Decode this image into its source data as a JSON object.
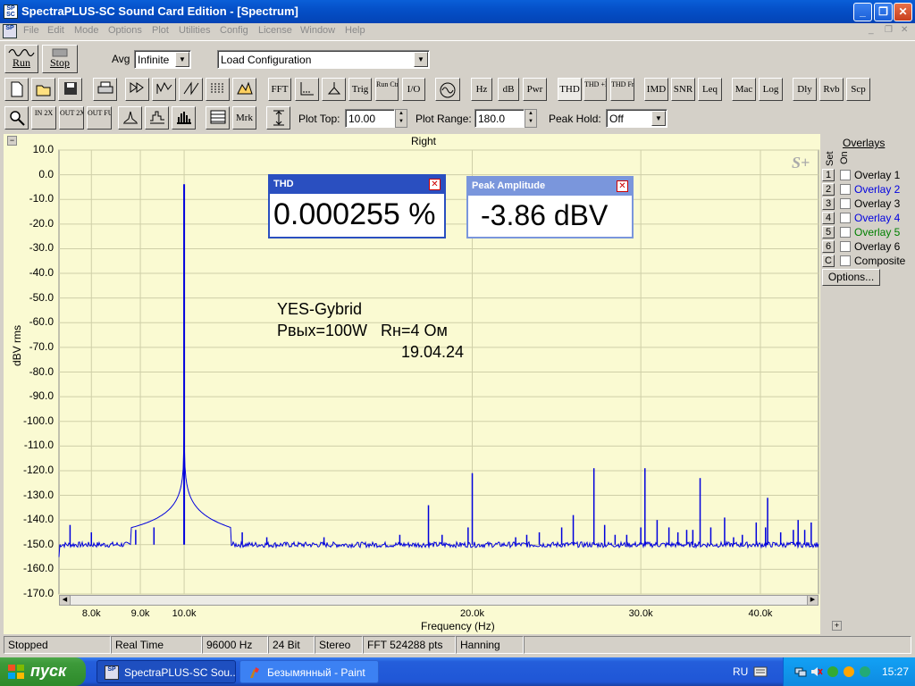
{
  "window": {
    "title": "SpectraPLUS-SC Sound Card Edition - [Spectrum]",
    "minimize": "_",
    "restore": "❐",
    "close": "✕"
  },
  "menu": [
    "File",
    "Edit",
    "Mode",
    "Options",
    "Plot",
    "Utilities",
    "Config",
    "License",
    "Window",
    "Help"
  ],
  "toolbar1": {
    "run_label": "Run",
    "stop_label": "Stop",
    "avg_label": "Avg",
    "avg_value": "Infinite",
    "config_value": "Load Configuration"
  },
  "toolbar2": {
    "fft": "FFT",
    "trig": "Trig",
    "run_ctrl": "Run Ctrl",
    "io": "I/O",
    "hz": "Hz",
    "db": "dB",
    "pwr": "Pwr",
    "thd": "THD",
    "thd_n": "THD +N",
    "thd_freq": "THD Freq",
    "imd": "IMD",
    "snr": "SNR",
    "leq": "Leq",
    "mac": "Mac",
    "log": "Log",
    "dly": "Dly",
    "rvb": "Rvb",
    "scp": "Scp"
  },
  "toolbar3": {
    "zoom_in": "IN 2X",
    "zoom_out": "OUT 2X",
    "zoom_full": "OUT FULL",
    "mrk": "Mrk",
    "plot_top_label": "Plot Top:",
    "plot_top_value": "10.00",
    "plot_range_label": "Plot Range:",
    "plot_range_value": "180.0",
    "peak_hold_label": "Peak Hold:",
    "peak_hold_value": "Off"
  },
  "plot": {
    "channel": "Right",
    "logo": "S+"
  },
  "chart_data": {
    "type": "line",
    "title": "Right",
    "xlabel": "Frequency (Hz)",
    "ylabel": "dBV rms",
    "xscale": "log",
    "xlim": [
      7400,
      46000
    ],
    "ylim": [
      -170,
      10
    ],
    "x_ticks": [
      {
        "v": 8000,
        "label": "8.0k"
      },
      {
        "v": 9000,
        "label": "9.0k"
      },
      {
        "v": 10000,
        "label": "10.0k"
      },
      {
        "v": 20000,
        "label": "20.0k"
      },
      {
        "v": 30000,
        "label": "30.0k"
      },
      {
        "v": 40000,
        "label": "40.0k"
      }
    ],
    "y_ticks": [
      {
        "v": 10,
        "label": "10.0"
      },
      {
        "v": 0,
        "label": "0.0"
      },
      {
        "v": -10,
        "label": "-10.0"
      },
      {
        "v": -20,
        "label": "-20.0"
      },
      {
        "v": -30,
        "label": "-30.0"
      },
      {
        "v": -40,
        "label": "-40.0"
      },
      {
        "v": -50,
        "label": "-50.0"
      },
      {
        "v": -60,
        "label": "-60.0"
      },
      {
        "v": -70,
        "label": "-70.0"
      },
      {
        "v": -80,
        "label": "-80.0"
      },
      {
        "v": -90,
        "label": "-90.0"
      },
      {
        "v": -100,
        "label": "-100.0"
      },
      {
        "v": -110,
        "label": "-110.0"
      },
      {
        "v": -120,
        "label": "-120.0"
      },
      {
        "v": -130,
        "label": "-130.0"
      },
      {
        "v": -140,
        "label": "-140.0"
      },
      {
        "v": -150,
        "label": "-150.0"
      },
      {
        "v": -160,
        "label": "-160.0"
      },
      {
        "v": -170,
        "label": "-170.0"
      }
    ],
    "grid": true,
    "noise_floor": -150,
    "fundamental": {
      "x": 10000,
      "y": -3.86
    },
    "spurs": [
      {
        "x": 7600,
        "y": -142
      },
      {
        "x": 8000,
        "y": -145
      },
      {
        "x": 8900,
        "y": -144
      },
      {
        "x": 9300,
        "y": -143
      },
      {
        "x": 11500,
        "y": -145
      },
      {
        "x": 12200,
        "y": -147
      },
      {
        "x": 14000,
        "y": -147
      },
      {
        "x": 16800,
        "y": -146
      },
      {
        "x": 18000,
        "y": -134
      },
      {
        "x": 18600,
        "y": -146
      },
      {
        "x": 20000,
        "y": -121
      },
      {
        "x": 19800,
        "y": -143
      },
      {
        "x": 22200,
        "y": -147
      },
      {
        "x": 22800,
        "y": -146
      },
      {
        "x": 23500,
        "y": -145
      },
      {
        "x": 24800,
        "y": -143
      },
      {
        "x": 25500,
        "y": -138
      },
      {
        "x": 26800,
        "y": -119
      },
      {
        "x": 27500,
        "y": -142
      },
      {
        "x": 28200,
        "y": -146
      },
      {
        "x": 29000,
        "y": -146
      },
      {
        "x": 30000,
        "y": -143
      },
      {
        "x": 30300,
        "y": -119
      },
      {
        "x": 31200,
        "y": -140
      },
      {
        "x": 32100,
        "y": -143
      },
      {
        "x": 32800,
        "y": -145
      },
      {
        "x": 33500,
        "y": -144
      },
      {
        "x": 34000,
        "y": -144
      },
      {
        "x": 34600,
        "y": -123
      },
      {
        "x": 35500,
        "y": -143
      },
      {
        "x": 36700,
        "y": -139
      },
      {
        "x": 37500,
        "y": -147
      },
      {
        "x": 38300,
        "y": -146
      },
      {
        "x": 39600,
        "y": -141
      },
      {
        "x": 40500,
        "y": -143
      },
      {
        "x": 40700,
        "y": -131
      },
      {
        "x": 42000,
        "y": -145
      },
      {
        "x": 43300,
        "y": -144
      },
      {
        "x": 43800,
        "y": -140
      },
      {
        "x": 44500,
        "y": -144
      },
      {
        "x": 45200,
        "y": -141
      }
    ]
  },
  "thd_meter": {
    "title": "THD",
    "value": "0.000255 %",
    "close": "✕"
  },
  "peak_meter": {
    "title": "Peak Amplitude",
    "value": "-3.86 dBV",
    "close": "✕"
  },
  "annotation": {
    "line1": "YES-Gybrid",
    "line2": "Pвых=100W   Rн=4 Ом",
    "line3": "19.04.24"
  },
  "overlays": {
    "title": "Overlays",
    "set_label": "Set",
    "on_label": "On",
    "items": [
      {
        "num": "1",
        "name": "Overlay 1",
        "color": "#000000"
      },
      {
        "num": "2",
        "name": "Overlay 2",
        "color": "#0000e0"
      },
      {
        "num": "3",
        "name": "Overlay 3",
        "color": "#000000"
      },
      {
        "num": "4",
        "name": "Overlay 4",
        "color": "#0000e0"
      },
      {
        "num": "5",
        "name": "Overlay 5",
        "color": "#008000"
      },
      {
        "num": "6",
        "name": "Overlay 6",
        "color": "#000000"
      },
      {
        "num": "C",
        "name": "Composite",
        "color": "#000000"
      }
    ],
    "options_button": "Options..."
  },
  "status": [
    "Stopped",
    "Real Time",
    "96000 Hz",
    "24 Bit",
    "Stereo",
    "FFT 524288 pts",
    "Hanning"
  ],
  "taskbar": {
    "start": "пуск",
    "tasks": [
      "SpectraPLUS-SC Sou...",
      "Безымянный - Paint"
    ],
    "lang": "RU",
    "time": "15:27"
  },
  "colors": {
    "trace": "#0000dd",
    "plot_bg": "#fafad2",
    "title_bar": "#0550c8",
    "meter_border": "#2a4fc0"
  }
}
